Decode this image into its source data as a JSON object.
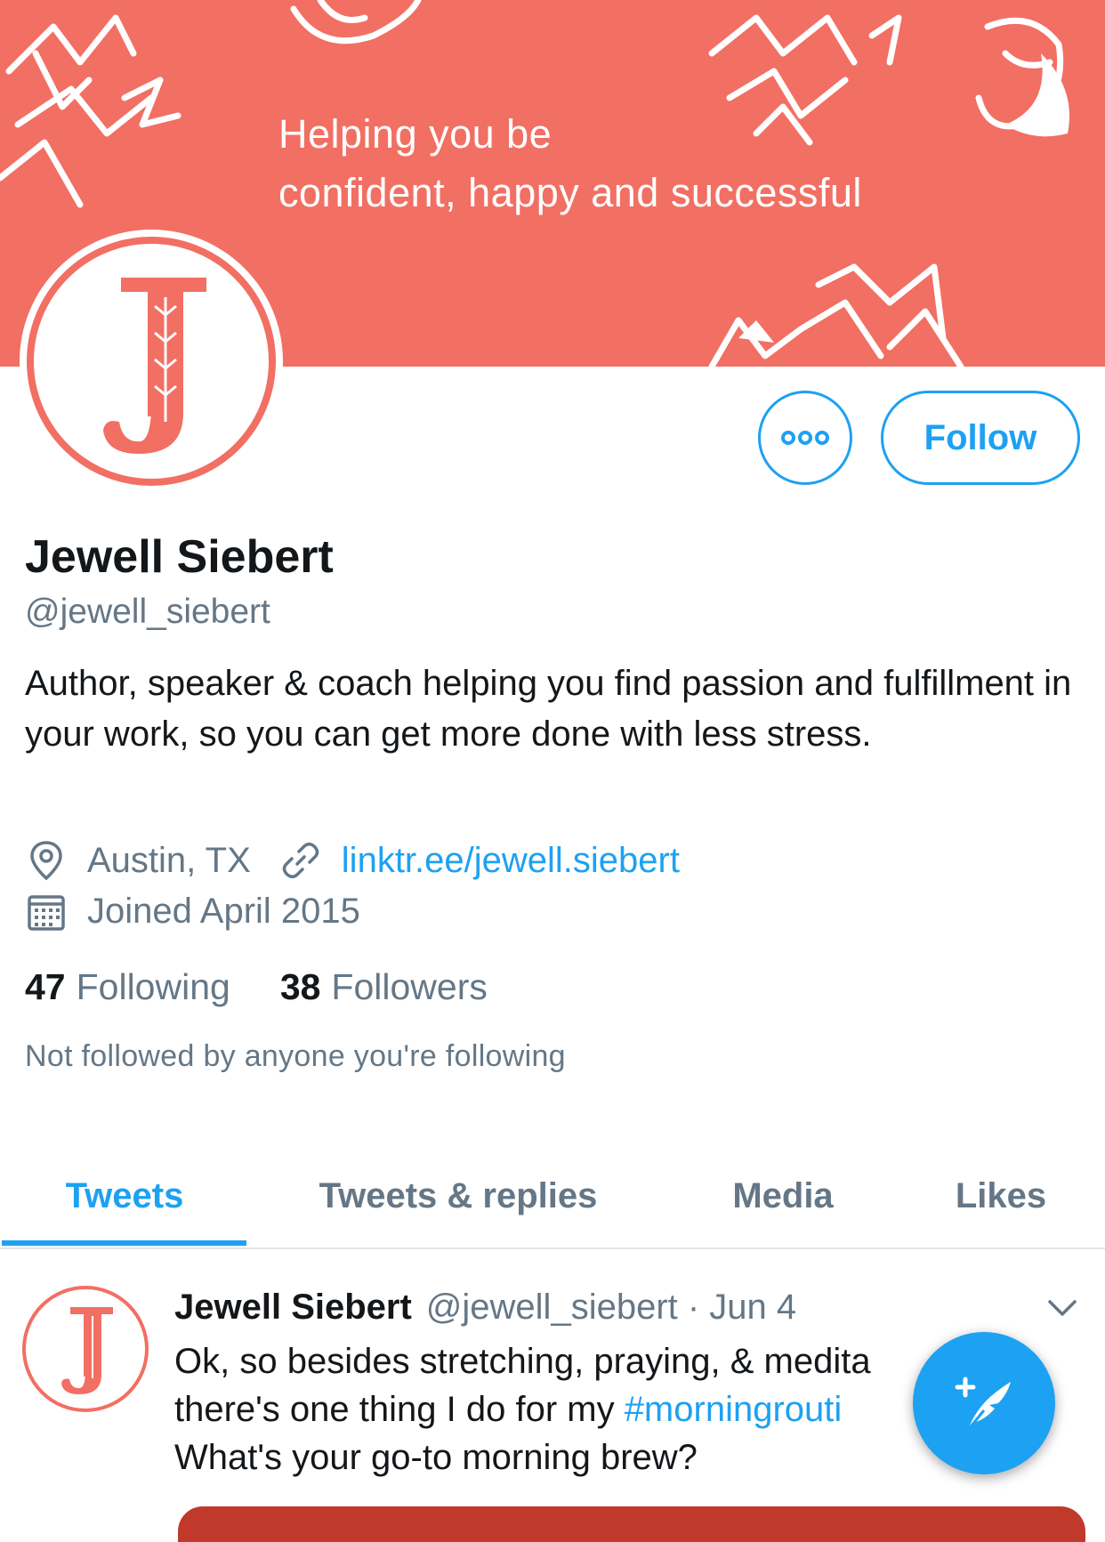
{
  "banner": {
    "line1": "Helping you be",
    "line2": "confident, happy and successful",
    "color": "#f26f63"
  },
  "profile": {
    "avatar_letter": "J",
    "name": "Jewell Siebert",
    "handle": "@jewell_siebert",
    "bio": "Author, speaker & coach helping you find passion and fulfillment in your work, so you can get more done with less stress.",
    "location": "Austin, TX",
    "website": "linktr.ee/jewell.siebert",
    "joined": "Joined April 2015",
    "following_count": "47",
    "following_label": "Following",
    "followers_count": "38",
    "followers_label": "Followers",
    "not_followed": "Not followed by anyone you're following"
  },
  "actions": {
    "follow_label": "Follow",
    "more_icon": "more-icon"
  },
  "tabs": [
    {
      "label": "Tweets",
      "active": true
    },
    {
      "label": "Tweets & replies",
      "active": false
    },
    {
      "label": "Media",
      "active": false
    },
    {
      "label": "Likes",
      "active": false
    }
  ],
  "tweet": {
    "name": "Jewell Siebert",
    "meta": "@jewell_siebert · Jun 4",
    "line1": "Ok, so besides stretching, praying, & medita",
    "line2_a": "there's one thing I do for my ",
    "line2_tag": "#morningrouti",
    "line3": "What's your go-to morning brew?"
  },
  "colors": {
    "accent": "#1da1f2",
    "secondary_text": "#657786",
    "brand": "#f26f63"
  }
}
